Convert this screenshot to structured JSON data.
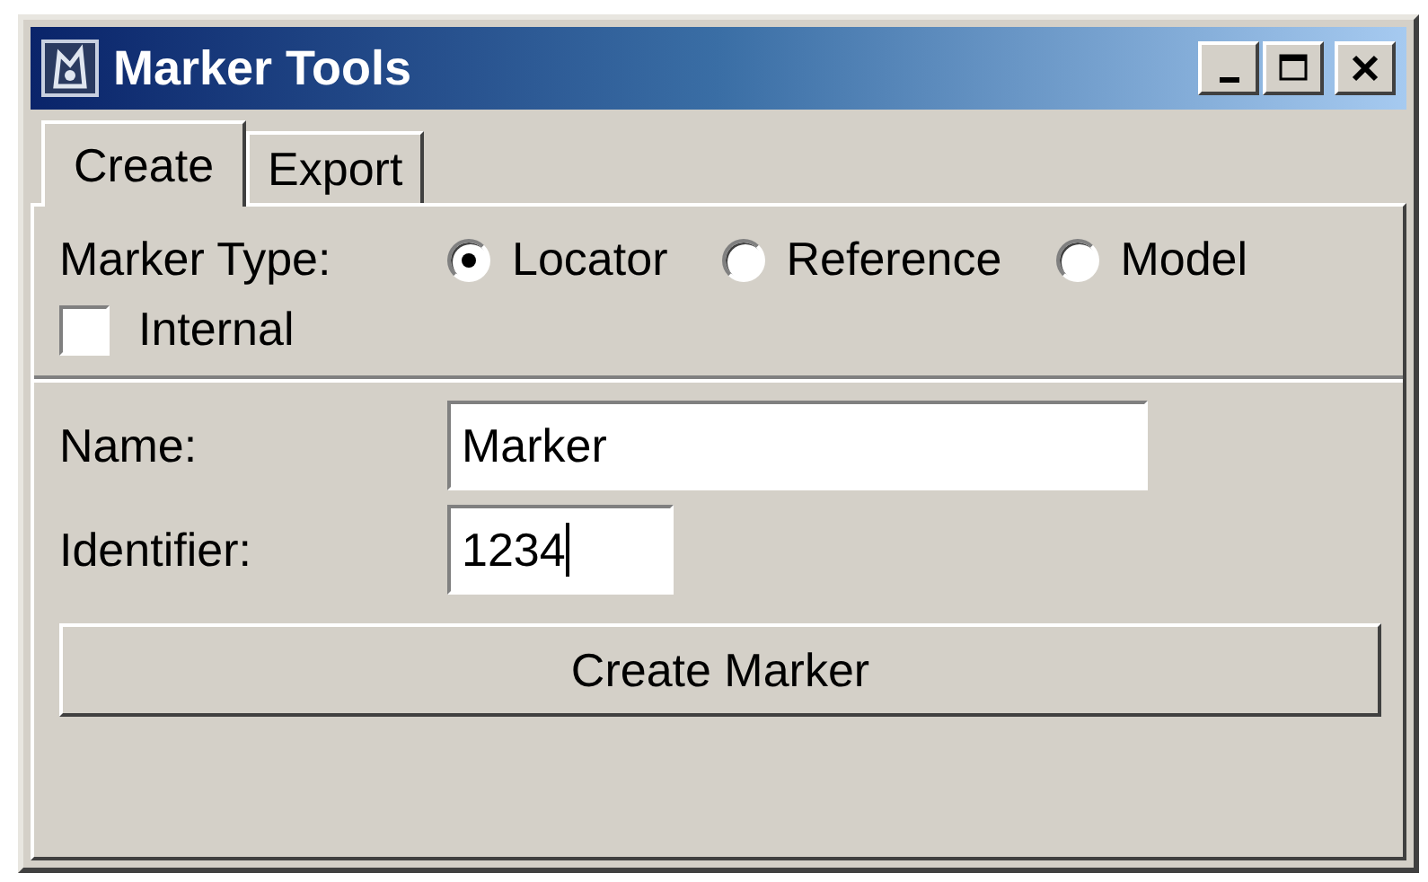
{
  "window": {
    "title": "Marker Tools"
  },
  "tabs": [
    {
      "label": "Create",
      "selected": true
    },
    {
      "label": "Export",
      "selected": false
    }
  ],
  "marker_type": {
    "label": "Marker Type:",
    "options": [
      {
        "label": "Locator",
        "selected": true
      },
      {
        "label": "Reference",
        "selected": false
      },
      {
        "label": "Model",
        "selected": false
      }
    ]
  },
  "internal": {
    "label": "Internal",
    "checked": false
  },
  "fields": [
    {
      "label": "Name:",
      "value": "Marker",
      "focused": false
    },
    {
      "label": "Identifier:",
      "value": "1234",
      "focused": true
    }
  ],
  "button": {
    "label": "Create Marker"
  }
}
